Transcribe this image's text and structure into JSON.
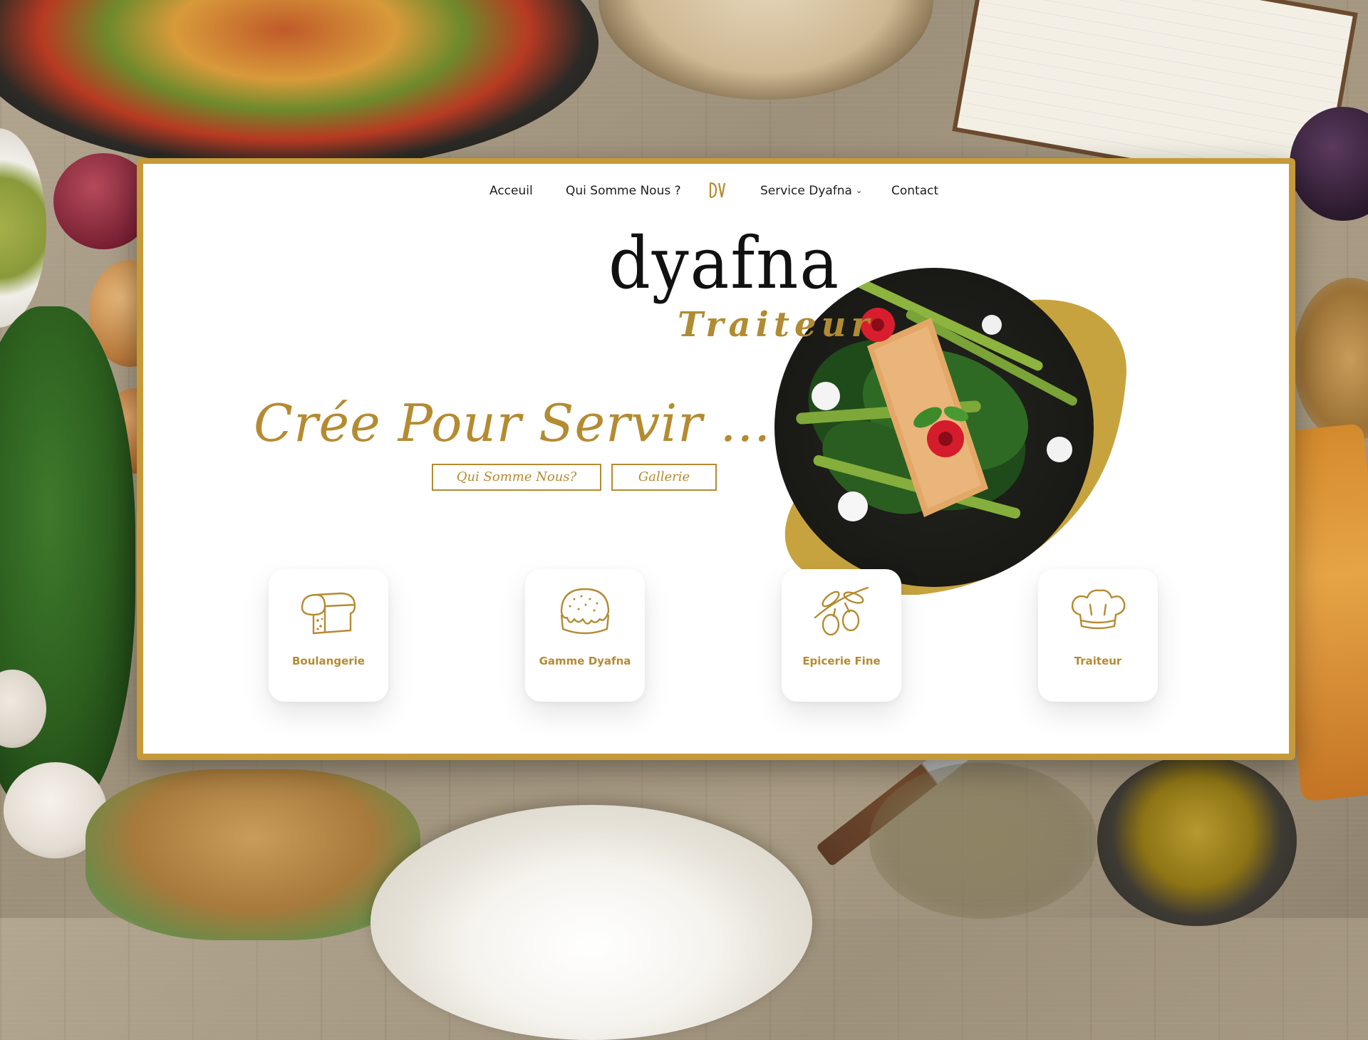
{
  "nav": {
    "items": [
      {
        "label": "Acceuil"
      },
      {
        "label": "Qui Somme Nous ?"
      },
      {
        "label": "Service Dyafna"
      },
      {
        "label": "Contact"
      }
    ],
    "logo_icon": "dyafna-monogram-icon"
  },
  "brand": {
    "name": "dyafna",
    "subtitle": "Traiteur"
  },
  "hero": {
    "tagline": "Crée Pour Servir ...",
    "buttons": [
      {
        "label": "Qui Somme Nous?"
      },
      {
        "label": "Gallerie"
      }
    ],
    "image_icon": "salmon-dish-photo"
  },
  "services": [
    {
      "label": "Boulangerie",
      "icon": "bread-loaf-icon"
    },
    {
      "label": "Gamme Dyafna",
      "icon": "cake-icon"
    },
    {
      "label": "Epicerie Fine",
      "icon": "olive-branch-icon"
    },
    {
      "label": "Traiteur",
      "icon": "chef-hat-icon"
    }
  ],
  "colors": {
    "accent": "#b58b32",
    "frame": "#c59a3b",
    "text": "#1d1d1d"
  }
}
